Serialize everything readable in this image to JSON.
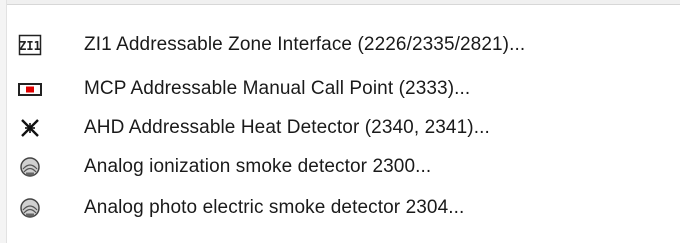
{
  "menu": {
    "items": [
      {
        "label": "ZI1 Addressable Zone Interface (2226/2335/2821)...",
        "icon": "zone-interface-icon"
      },
      {
        "label": "MCP Addressable Manual Call Point (2333)...",
        "icon": "manual-call-point-icon"
      },
      {
        "label": "AHD Addressable Heat Detector (2340, 2341)...",
        "icon": "heat-detector-icon"
      },
      {
        "label": "Analog ionization smoke detector 2300...",
        "icon": "smoke-detector-icon"
      },
      {
        "label": "Analog photo electric smoke detector 2304...",
        "icon": "smoke-detector-icon"
      }
    ]
  },
  "colors": {
    "text": "#1a1a1a",
    "background": "#ffffff",
    "mcp_red": "#e00000"
  }
}
